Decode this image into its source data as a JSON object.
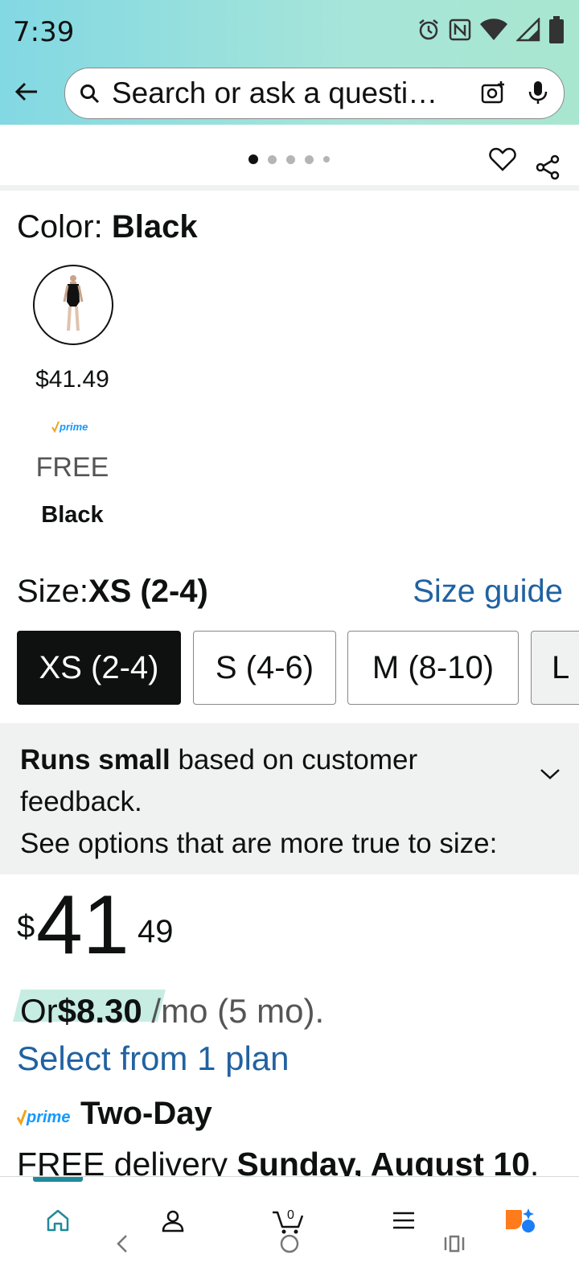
{
  "status": {
    "time": "7:39"
  },
  "search": {
    "placeholder": "Search or ask a questi…"
  },
  "carousel": {
    "total_pages": 5,
    "active_page": 1
  },
  "color": {
    "label": "Color:",
    "value": "Black"
  },
  "swatch": {
    "price": "$41.49",
    "prime": "prime",
    "shipping": "FREE",
    "name": "Black"
  },
  "size": {
    "label": "Size:",
    "value": "XS (2-4)",
    "guide_link": "Size guide",
    "options": [
      "XS (2-4)",
      "S (4-6)",
      "M (8-10)",
      "L"
    ],
    "selected": "XS (2-4)"
  },
  "fit": {
    "bold": "Runs small",
    "rest": " based on customer feedback.",
    "line2": "See options that are more true to size:"
  },
  "price": {
    "symbol": "$",
    "whole": "41",
    "fraction": "49"
  },
  "installment": {
    "prefix": "Or",
    "amount": "$8.30",
    "suffix": " /mo (5 mo).",
    "plan_link": "Select from 1 plan"
  },
  "delivery": {
    "prime": "prime",
    "speed": "Two-Day",
    "prefix": "FREE delivery ",
    "date": "Sunday, August 10",
    "suffix": "."
  },
  "nav": {
    "cart_count": "0"
  },
  "colors": {
    "link": "#2162a1",
    "prime_blue": "#1399ff",
    "prime_check": "#f0a41b",
    "selected_size_bg": "#0f1111",
    "nav_accent": "#218a9a"
  },
  "icons": [
    "back-arrow-icon",
    "search-icon",
    "camera-icon",
    "mic-icon",
    "heart-icon",
    "share-icon",
    "chevron-down-icon",
    "home-icon",
    "account-icon",
    "cart-icon",
    "menu-icon",
    "rufus-icon"
  ]
}
